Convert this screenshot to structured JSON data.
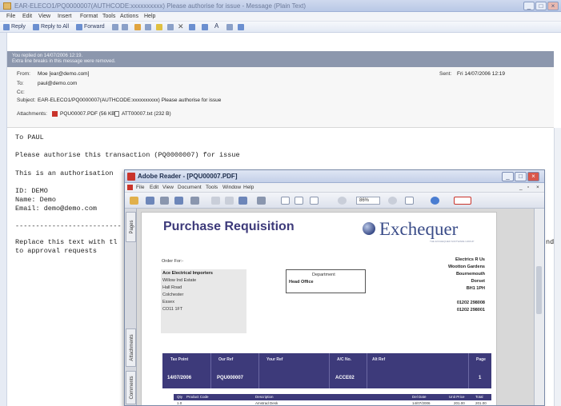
{
  "outlook": {
    "title": "EAR-ELECO1/PQ0000007(AUTHCODE:xxxxxxxxxx) Please authorise for issue - Message (Plain Text)",
    "menu": [
      "File",
      "Edit",
      "View",
      "Insert",
      "Format",
      "Tools",
      "Actions",
      "Help"
    ],
    "toolbar": {
      "reply": "Reply",
      "reply_all": "Reply to All",
      "forward": "Forward"
    },
    "info_line1": "You replied on 14/07/2006 12:19.",
    "info_line2": "Extra line breaks in this message were removed.",
    "header": {
      "from_label": "From:",
      "from_value": "Moe [ear@demo.com]",
      "to_label": "To:",
      "to_value": "paul@demo.com",
      "cc_label": "Cc:",
      "cc_value": "",
      "subject_label": "Subject:",
      "subject_value": "EAR-ELECO1/PQ0000007(AUTHCODE:xxxxxxxxxx) Please authorise for issue",
      "attachments_label": "Attachments:",
      "attachment_1": "PQU00007.PDF (56 KB);",
      "attachment_2": "ATT00007.txt (232 B)",
      "sent_label": "Sent:",
      "sent_value": "Fri 14/07/2006 12:19"
    },
    "body": {
      "line1": "To PAUL",
      "line2": "Please authorise this transaction (PQ0000007) for issue",
      "line3": "This is an authorisation",
      "id_line": "ID:     DEMO",
      "name_line": "Name:   Demo",
      "email_line": "Email:  demo@demo.com",
      "separator": "--------------------------",
      "replace_line1": "Replace this text with tl",
      "replace_line2": "to approval requests",
      "clipped_right": "nd"
    }
  },
  "reader": {
    "title": "Adobe Reader - [PQU00007.PDF]",
    "menu": [
      "File",
      "Edit",
      "View",
      "Document",
      "Tools",
      "Window",
      "Help"
    ],
    "zoom": "86%",
    "nav_tabs": [
      "Pages",
      "Attachments",
      "Comments"
    ],
    "pdf": {
      "title": "Purchase Requisition",
      "logo_text": "Exchequer",
      "logo_tagline": "THE EXCHEQUER SOFTWARE GROUP",
      "order_for_label": "Order For:-",
      "order_for_lines": [
        "Ace Electrical Importers",
        "Willow Ind Estate",
        "Hall Road",
        "Colchester",
        "Essex",
        "CO11 1FT"
      ],
      "dept_label": "Department",
      "dept_value": "Head Office",
      "supplier_lines": [
        "Electrics R Us",
        "Wootton Gardens",
        "Bournemouth",
        "Dorset",
        "BH1 1PH",
        "",
        "01202 298008",
        "01202 298001"
      ],
      "ref_headers": [
        "Tax Point",
        "Our Ref",
        "Your Ref",
        "A/C No.",
        "Alt Ref",
        "Page"
      ],
      "ref_values": [
        "14/07/2006",
        "PQU000007",
        "",
        "ACCE02",
        "",
        "1"
      ],
      "item_headers": [
        "Qty",
        "Product Code",
        "Description",
        "Del Date",
        "Unit Price",
        "Total"
      ],
      "item_row": [
        "1.0",
        "",
        "Amstrad Desk",
        "14/07/2006",
        "201.00",
        "201.00"
      ]
    }
  }
}
